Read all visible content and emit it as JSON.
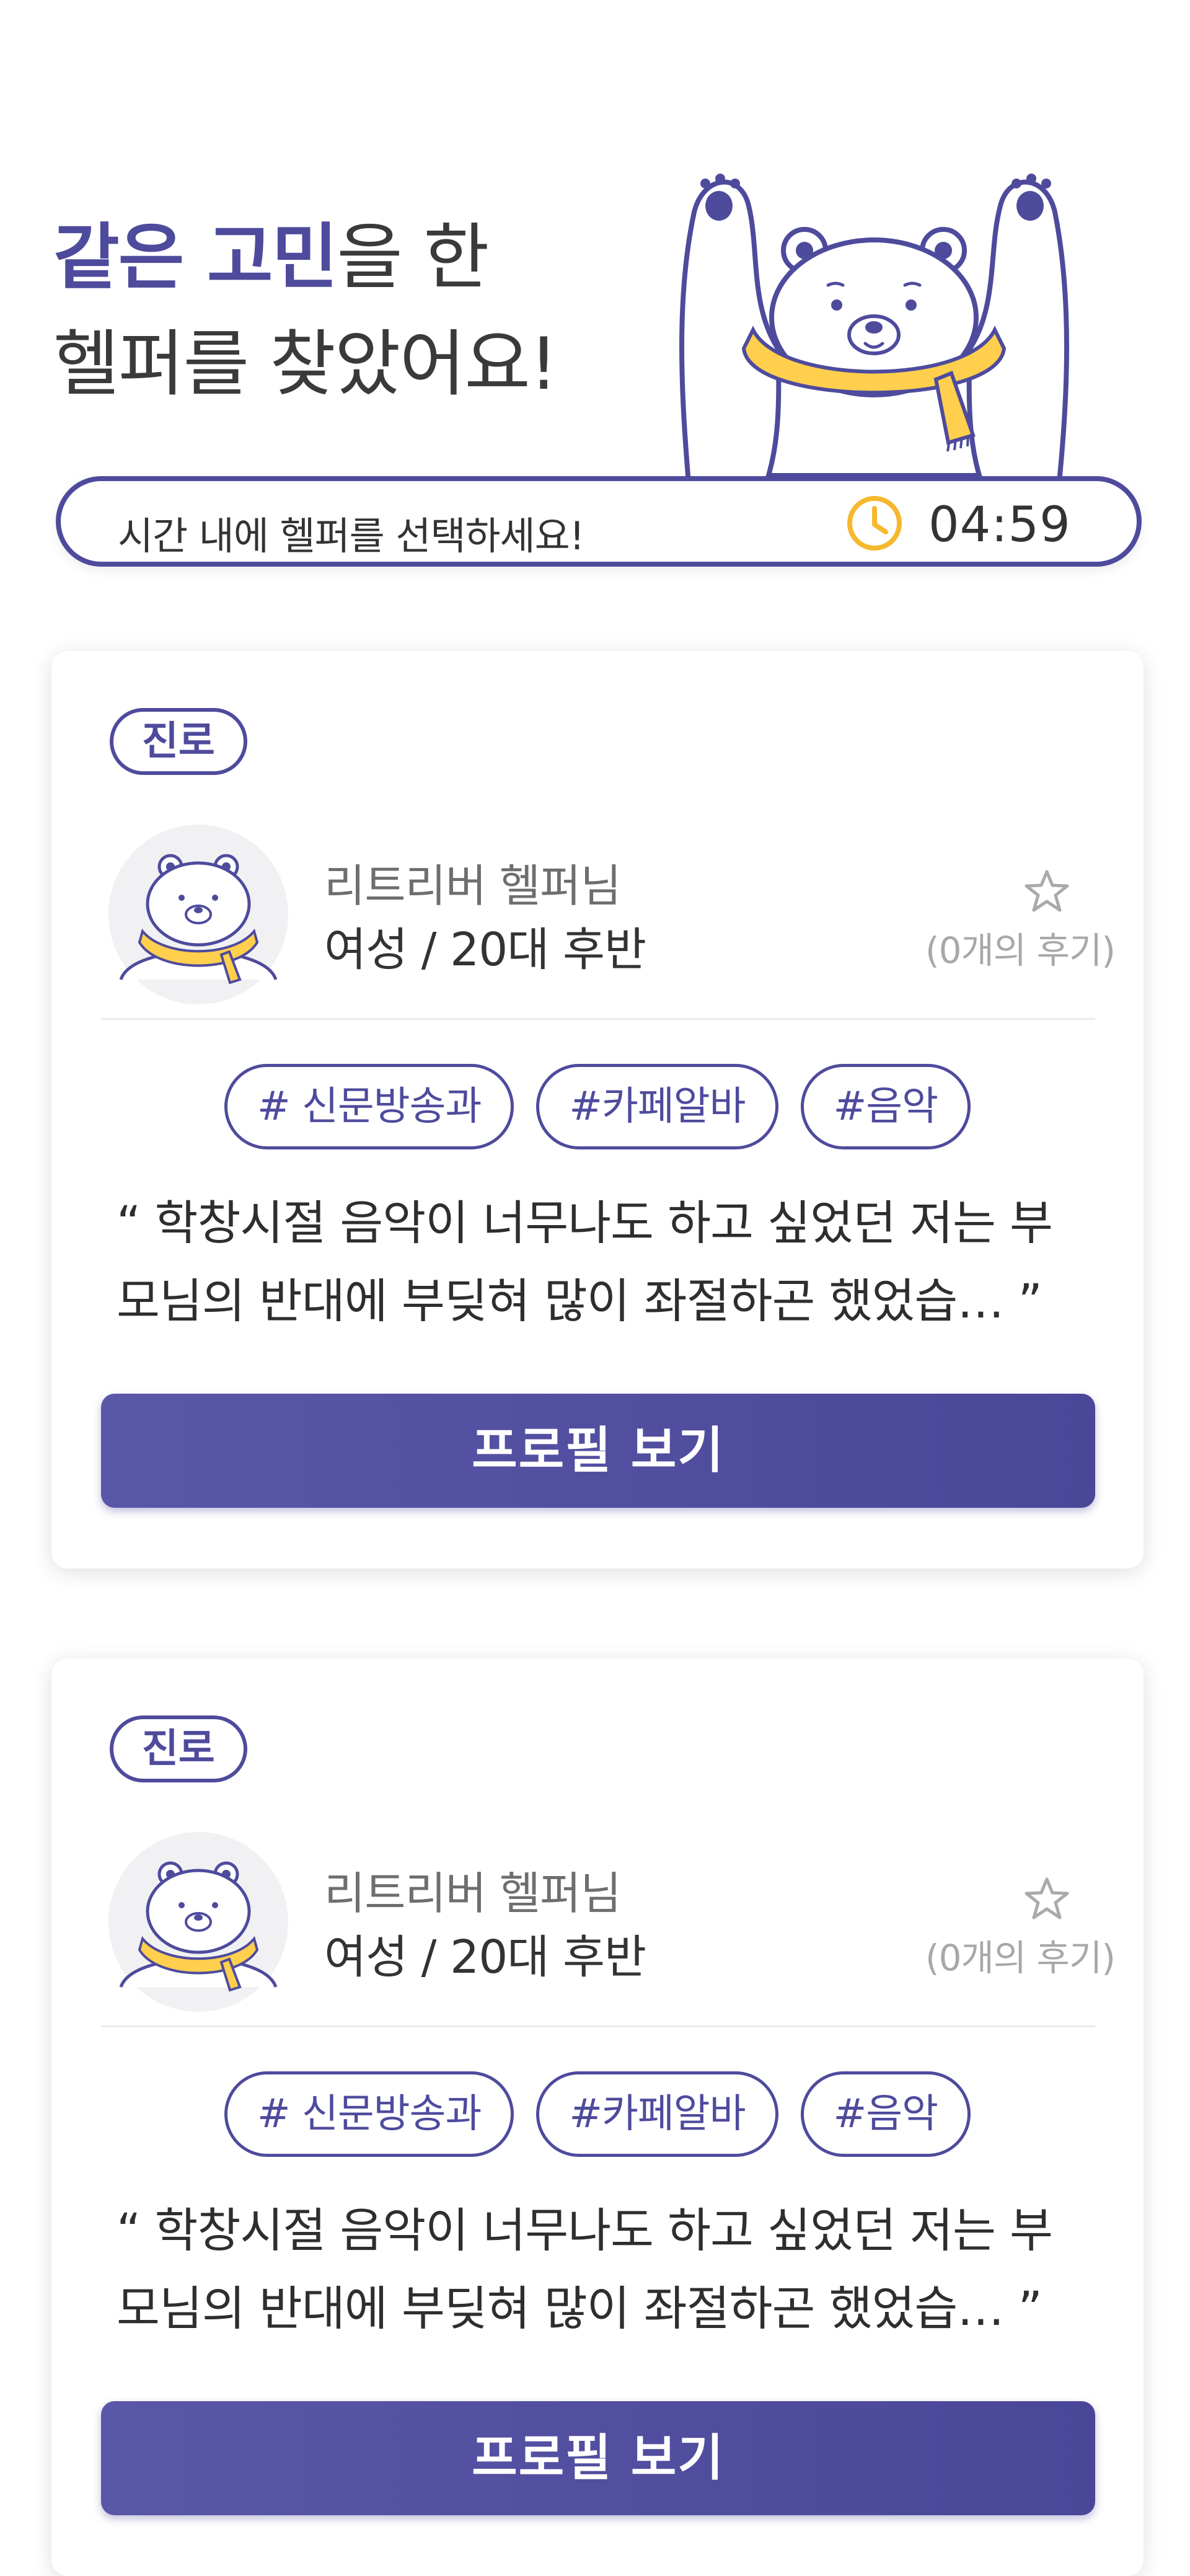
{
  "hero": {
    "headline_accent": "같은 고민",
    "headline_rest": "을 한",
    "headline_line2": "헬퍼를 찾았어요!"
  },
  "timer": {
    "message": "시간 내에 헬퍼를 선택하세요!",
    "value": "04:59",
    "icon": "clock-icon"
  },
  "colors": {
    "accent": "#4e4b9d",
    "scarf": "#ffcf4d",
    "button": "#4e4b9d"
  },
  "cards": [
    {
      "category": "진로",
      "helper_name": "리트리버 헬퍼님",
      "helper_info": "여성 / 20대 후반",
      "favorite_icon": "star-outline-icon",
      "reviews": "(0개의 후기)",
      "tags": [
        "# 신문방송과",
        "#카페알바",
        "#음악"
      ],
      "quote_line1": "“ 학창시절 음악이 너무나도 하고 싶었던 저는 부",
      "quote_line2": "모님의 반대에 부딪혀 많이 좌절하곤 했었습… ”",
      "button_label": "프로필 보기"
    },
    {
      "category": "진로",
      "helper_name": "리트리버 헬퍼님",
      "helper_info": "여성 / 20대 후반",
      "favorite_icon": "star-outline-icon",
      "reviews": "(0개의 후기)",
      "tags": [
        "# 신문방송과",
        "#카페알바",
        "#음악"
      ],
      "quote_line1": "“ 학창시절 음악이 너무나도 하고 싶었던 저는 부",
      "quote_line2": "모님의 반대에 부딪혀 많이 좌절하곤 했었습… ”",
      "button_label": "프로필 보기"
    }
  ]
}
